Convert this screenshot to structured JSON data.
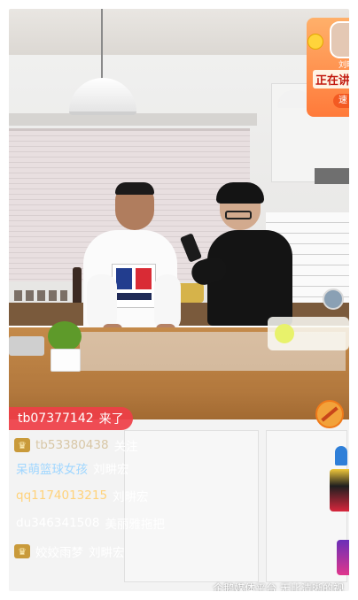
{
  "live_banner": {
    "host_name": "刘畊",
    "status_text": "正在讲",
    "button_label": "速"
  },
  "chat": {
    "entry_notice": {
      "user": "tb07377142",
      "action": "来了"
    },
    "messages": [
      {
        "user": "tb53380438",
        "text": "关注",
        "badge": "crown-icon",
        "name_color": "#d8c7a6"
      },
      {
        "user": "呆萌篮球女孩",
        "text": "刘畊宏",
        "badge": "",
        "name_color": "#9fd6ff"
      },
      {
        "user": "qq1174013215",
        "text": "刘畊宏",
        "badge": "",
        "name_color": "#ffd27a"
      },
      {
        "user": "du346341508",
        "text": "美丽雅拖把",
        "badge": "",
        "name_color": "#ffffff"
      },
      {
        "user": "姣姣雨梦",
        "text": "刘畊宏",
        "badge": "crown-icon",
        "name_color": "#ffffff"
      }
    ]
  },
  "watermark": "企鹅媒体平台 无比清晰的视",
  "colors": {
    "entry_bg": "#ef3e47",
    "banner_bg": "#ff8a44",
    "accent_red": "#c21a10"
  },
  "icons": [
    "crown-icon",
    "no-entry-icon",
    "basket-icon",
    "bag-icon"
  ]
}
